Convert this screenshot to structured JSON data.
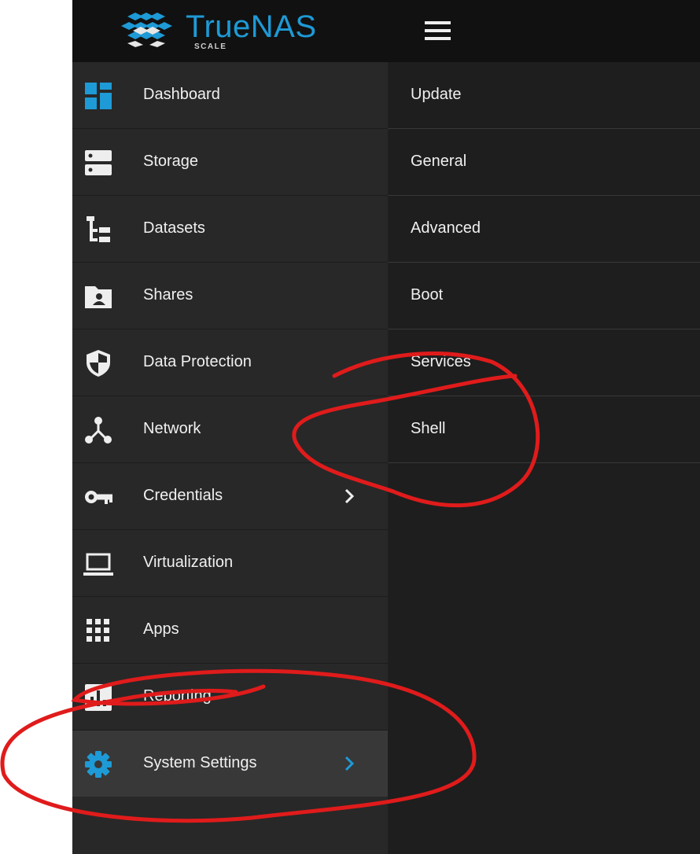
{
  "brand": {
    "name": "TrueNAS",
    "edition": "SCALE",
    "logo_icon": "truenas-logo-icon"
  },
  "header": {
    "menu_icon": "hamburger-menu-icon"
  },
  "colors": {
    "accent": "#1e9ad6",
    "annotation": "#e01b1b"
  },
  "sidebar": {
    "items": [
      {
        "label": "Dashboard",
        "icon": "dashboard-icon"
      },
      {
        "label": "Storage",
        "icon": "storage-icon"
      },
      {
        "label": "Datasets",
        "icon": "datasets-icon"
      },
      {
        "label": "Shares",
        "icon": "shares-icon"
      },
      {
        "label": "Data Protection",
        "icon": "shield-icon"
      },
      {
        "label": "Network",
        "icon": "network-icon"
      },
      {
        "label": "Credentials",
        "icon": "key-icon"
      },
      {
        "label": "Virtualization",
        "icon": "laptop-icon"
      },
      {
        "label": "Apps",
        "icon": "apps-grid-icon"
      },
      {
        "label": "Reporting",
        "icon": "reporting-icon"
      },
      {
        "label": "System Settings",
        "icon": "gear-icon"
      }
    ]
  },
  "system_settings_menu": {
    "items": [
      {
        "label": "Update"
      },
      {
        "label": "General"
      },
      {
        "label": "Advanced"
      },
      {
        "label": "Boot"
      },
      {
        "label": "Services"
      },
      {
        "label": "Shell"
      }
    ]
  }
}
